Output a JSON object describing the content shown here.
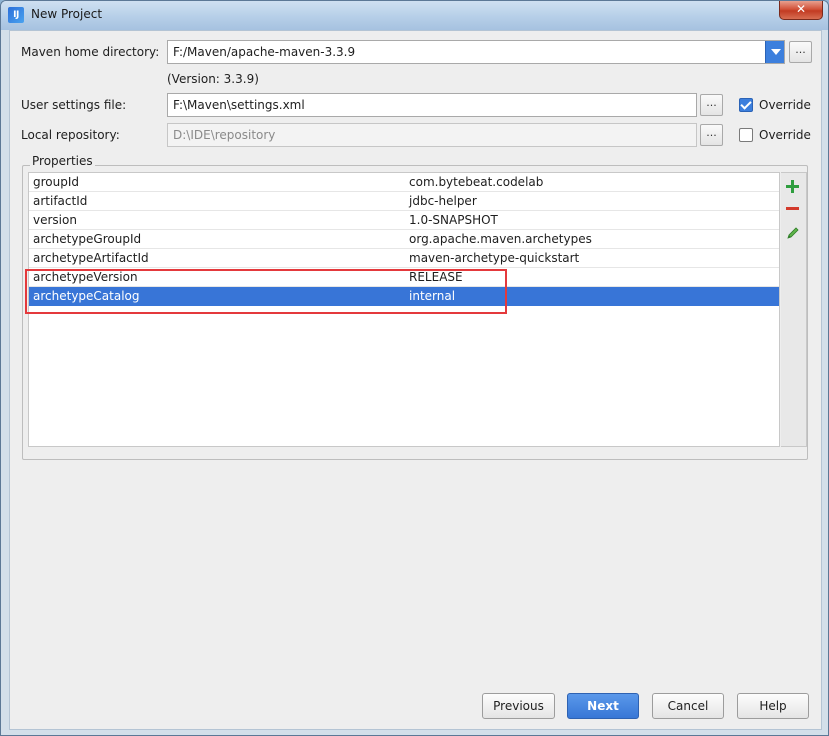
{
  "window": {
    "title": "New Project",
    "close_glyph": "✕",
    "app_icon_text": "IJ"
  },
  "maven_home": {
    "label": "Maven home directory:",
    "value": "F:/Maven/apache-maven-3.3.9",
    "version_note": "(Version: 3.3.9)",
    "browse_glyph": "..."
  },
  "user_settings": {
    "label": "User settings file:",
    "value": "F:\\Maven\\settings.xml",
    "browse_glyph": "...",
    "override_label": "Override",
    "override_checked": true
  },
  "local_repo": {
    "label": "Local repository:",
    "value": "D:\\IDE\\repository",
    "browse_glyph": "...",
    "override_label": "Override",
    "override_checked": false
  },
  "properties": {
    "title": "Properties",
    "rows": [
      {
        "key": "groupId",
        "value": "com.bytebeat.codelab",
        "selected": false
      },
      {
        "key": "artifactId",
        "value": "jdbc-helper",
        "selected": false
      },
      {
        "key": "version",
        "value": "1.0-SNAPSHOT",
        "selected": false
      },
      {
        "key": "archetypeGroupId",
        "value": "org.apache.maven.archetypes",
        "selected": false
      },
      {
        "key": "archetypeArtifactId",
        "value": "maven-archetype-quickstart",
        "selected": false
      },
      {
        "key": "archetypeVersion",
        "value": "RELEASE",
        "selected": false
      },
      {
        "key": "archetypeCatalog",
        "value": "internal",
        "selected": true
      }
    ],
    "toolbar_icons": [
      "plus-icon",
      "minus-icon",
      "pencil-icon"
    ]
  },
  "buttons": {
    "previous": "Previous",
    "next": "Next",
    "cancel": "Cancel",
    "help": "Help"
  },
  "colors": {
    "selection": "#3875d7",
    "highlight_box": "#e4393c",
    "add_green": "#2f9e3f",
    "remove_red": "#d33a2c"
  }
}
